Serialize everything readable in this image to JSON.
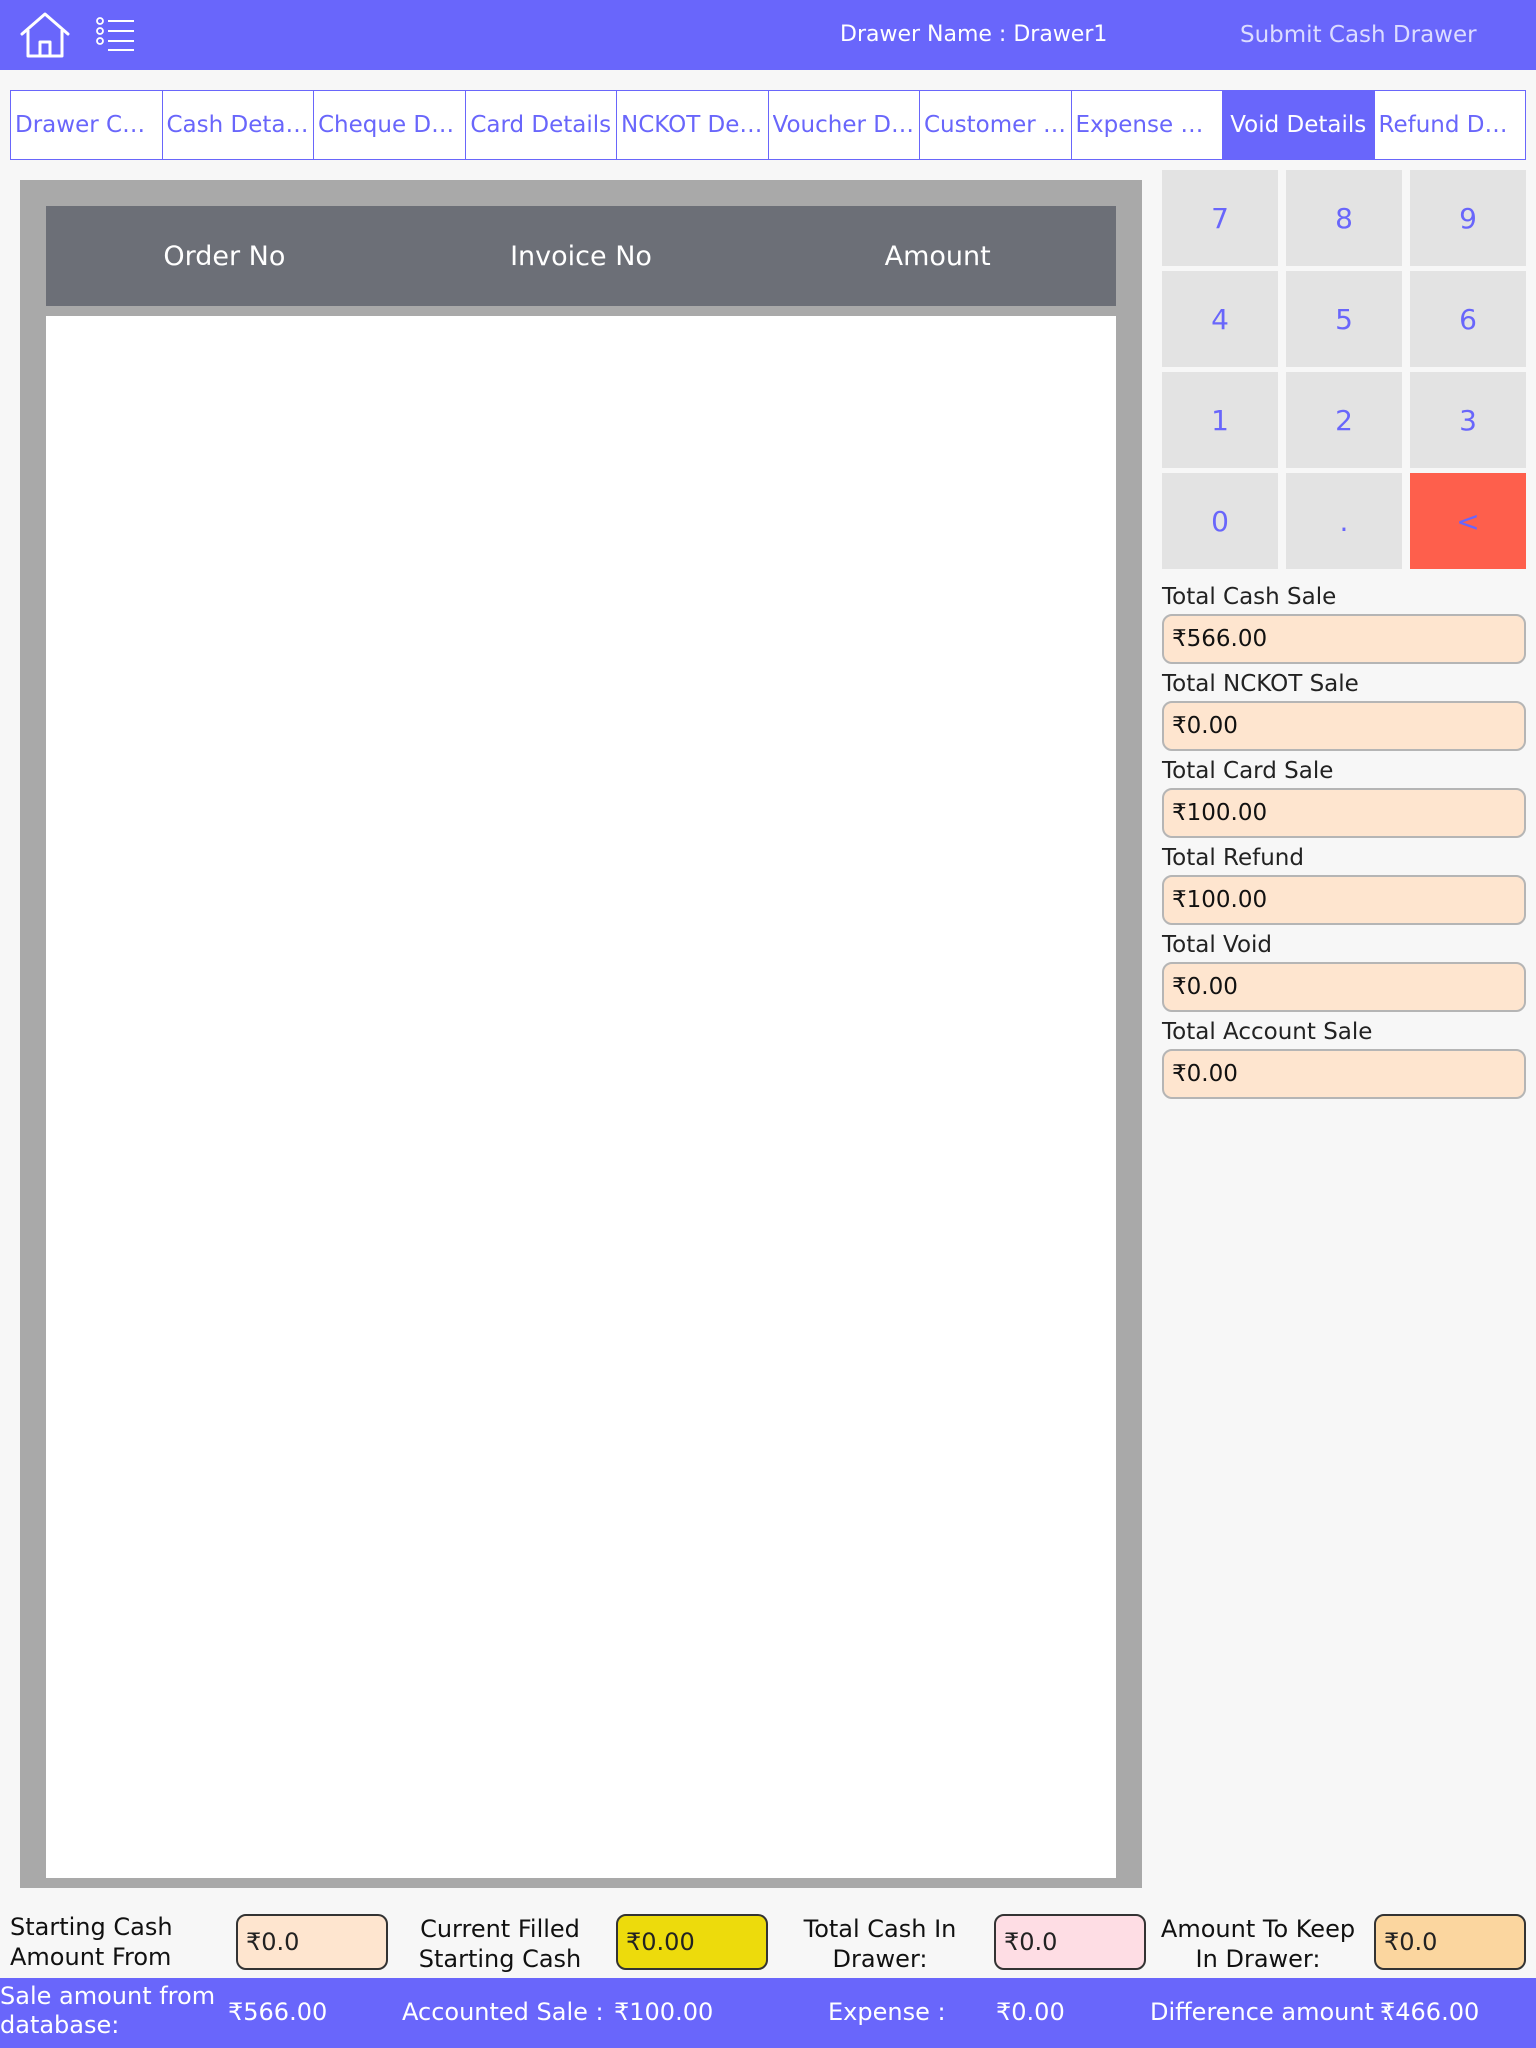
{
  "header": {
    "drawer_name": "Drawer Name : Drawer1",
    "submit_label": "Submit Cash Drawer",
    "bg_color": "#6966fb",
    "home_icon": "home-icon",
    "menu_icon": "list-icon"
  },
  "tabs": [
    {
      "label": "Drawer Cash",
      "active": false
    },
    {
      "label": "Cash Details",
      "active": false
    },
    {
      "label": "Cheque Det...",
      "active": false
    },
    {
      "label": "Card Details",
      "active": false
    },
    {
      "label": "NCKOT Det...",
      "active": false
    },
    {
      "label": "Voucher Det...",
      "active": false
    },
    {
      "label": "Customer A...",
      "active": false
    },
    {
      "label": "Expense Det...",
      "active": false
    },
    {
      "label": "Void Details",
      "active": true
    },
    {
      "label": "Refund Deta...",
      "active": false
    }
  ],
  "table": {
    "columns": [
      "Order No",
      "Invoice No",
      "Amount"
    ],
    "rows": []
  },
  "keypad": {
    "keys": [
      "7",
      "8",
      "9",
      "4",
      "5",
      "6",
      "1",
      "2",
      "3",
      "0",
      ".",
      "<"
    ],
    "backspace_color": "#fe5f4c"
  },
  "totals": [
    {
      "label": "Total Cash Sale",
      "value": "₹566.00"
    },
    {
      "label": "Total NCKOT Sale",
      "value": "₹0.00"
    },
    {
      "label": "Total Card Sale",
      "value": "₹100.00"
    },
    {
      "label": "Total Refund",
      "value": "₹100.00"
    },
    {
      "label": "Total Void",
      "value": "₹0.00"
    },
    {
      "label": "Total Account Sale",
      "value": "₹0.00"
    }
  ],
  "bottom": {
    "starting_cash_label": "Starting Cash Amount From",
    "starting_cash_value": "₹0.0",
    "current_filled_label": "Current Filled Starting Cash Total:",
    "current_filled_value": "₹0.00",
    "total_cash_label": "Total Cash In Drawer:",
    "total_cash_value": "₹0.0",
    "keep_label": "Amount To Keep In Drawer:",
    "keep_value": "₹0.0"
  },
  "footer": {
    "sale_label": "Sale amount from database:",
    "sale_value": "₹566.00",
    "accounted_label": "Accounted Sale :",
    "accounted_value": "₹100.00",
    "expense_label": "Expense :",
    "expense_value": "₹0.00",
    "difference_label": "Difference amount :",
    "difference_value": "₹466.00"
  }
}
